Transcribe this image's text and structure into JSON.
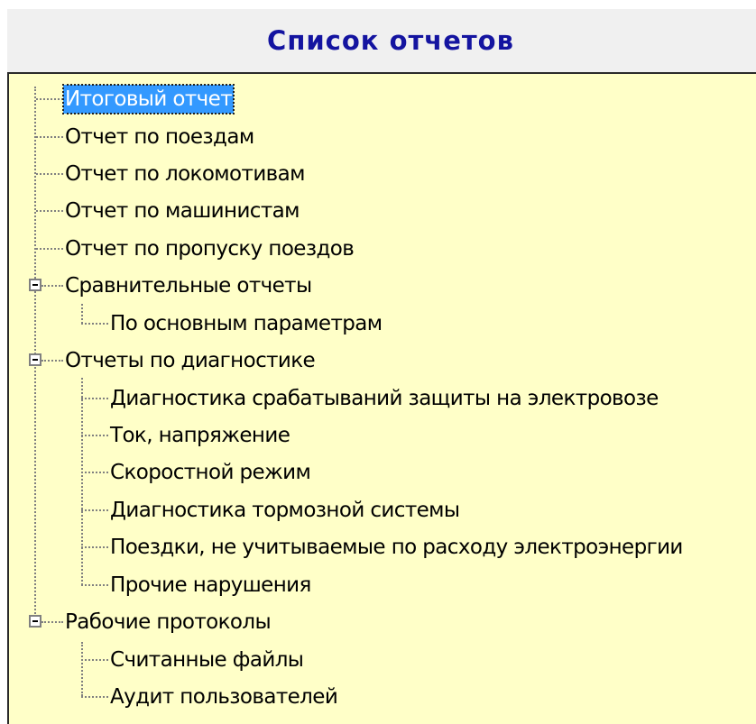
{
  "window": {
    "title": "Список отчетов"
  },
  "tree": {
    "items": [
      {
        "label": "Итоговый отчет",
        "level": 0,
        "selected": true
      },
      {
        "label": "Отчет по поездам",
        "level": 0
      },
      {
        "label": "Отчет по локомотивам",
        "level": 0
      },
      {
        "label": "Отчет по машинистам",
        "level": 0
      },
      {
        "label": "Отчет по пропуску поездов",
        "level": 0
      },
      {
        "label": "Сравнительные отчеты",
        "level": 0,
        "expanded": true
      },
      {
        "label": "По основным параметрам",
        "level": 1
      },
      {
        "label": "Отчеты по диагностике",
        "level": 0,
        "expanded": true
      },
      {
        "label": "Диагностика срабатываний защиты на электровозе",
        "level": 1
      },
      {
        "label": "Ток, напряжение",
        "level": 1
      },
      {
        "label": "Скоростной режим",
        "level": 1
      },
      {
        "label": "Диагностика тормозной системы",
        "level": 1
      },
      {
        "label": "Поездки, не учитываемые по расходу электроэнергии",
        "level": 1
      },
      {
        "label": "Прочие нарушения",
        "level": 1
      },
      {
        "label": "Рабочие протоколы",
        "level": 0,
        "expanded": true
      },
      {
        "label": "Считанные файлы",
        "level": 1
      },
      {
        "label": "Аудит пользователей",
        "level": 1
      }
    ]
  },
  "colors": {
    "header_text": "#1414a0",
    "tree_background": "#ffffc8",
    "selection": "#3399ff"
  },
  "icons": {
    "expander": "minus-box-icon"
  }
}
